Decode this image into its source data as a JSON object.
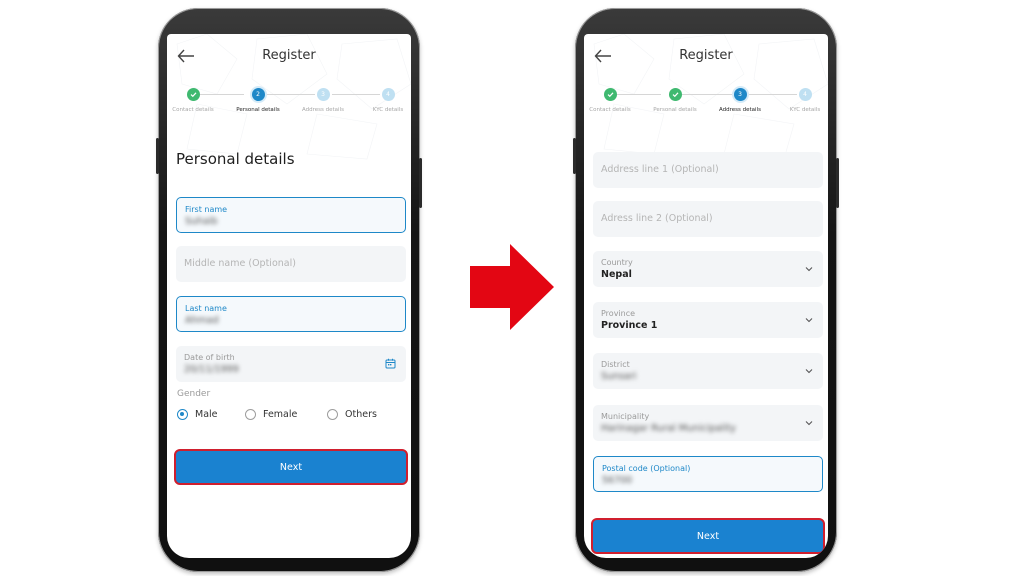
{
  "header": {
    "title": "Register"
  },
  "steps": [
    "Contact details",
    "Personal details",
    "Address details",
    "KYC details"
  ],
  "screen1": {
    "heading": "Personal details",
    "fields": {
      "first_name": {
        "label": "First name",
        "value": "Suhaib"
      },
      "middle_name": {
        "placeholder": "Middle name (Optional)"
      },
      "last_name": {
        "label": "Last name",
        "value": "Ahmad"
      },
      "dob": {
        "label": "Date of birth",
        "value": "20/11/1999"
      }
    },
    "gender": {
      "label": "Gender",
      "options": [
        "Male",
        "Female",
        "Others"
      ],
      "selected": "Male"
    },
    "next_label": "Next"
  },
  "screen2": {
    "fields": {
      "address1": {
        "placeholder": "Address line 1 (Optional)"
      },
      "address2": {
        "placeholder": "Adress line 2 (Optional)"
      },
      "country": {
        "label": "Country",
        "value": "Nepal"
      },
      "province": {
        "label": "Province",
        "value": "Province 1"
      },
      "district": {
        "label": "District",
        "value": "Sunsari"
      },
      "municipality": {
        "label": "Municipality",
        "value": "Harinagar Rural Municipality"
      },
      "postal": {
        "label": "Postal code (Optional)",
        "value": "56700"
      }
    },
    "next_label": "Next"
  },
  "colors": {
    "accent": "#1a82d0",
    "done": "#3fb970",
    "highlight": "#d01f2e",
    "arrow": "#e30613"
  }
}
